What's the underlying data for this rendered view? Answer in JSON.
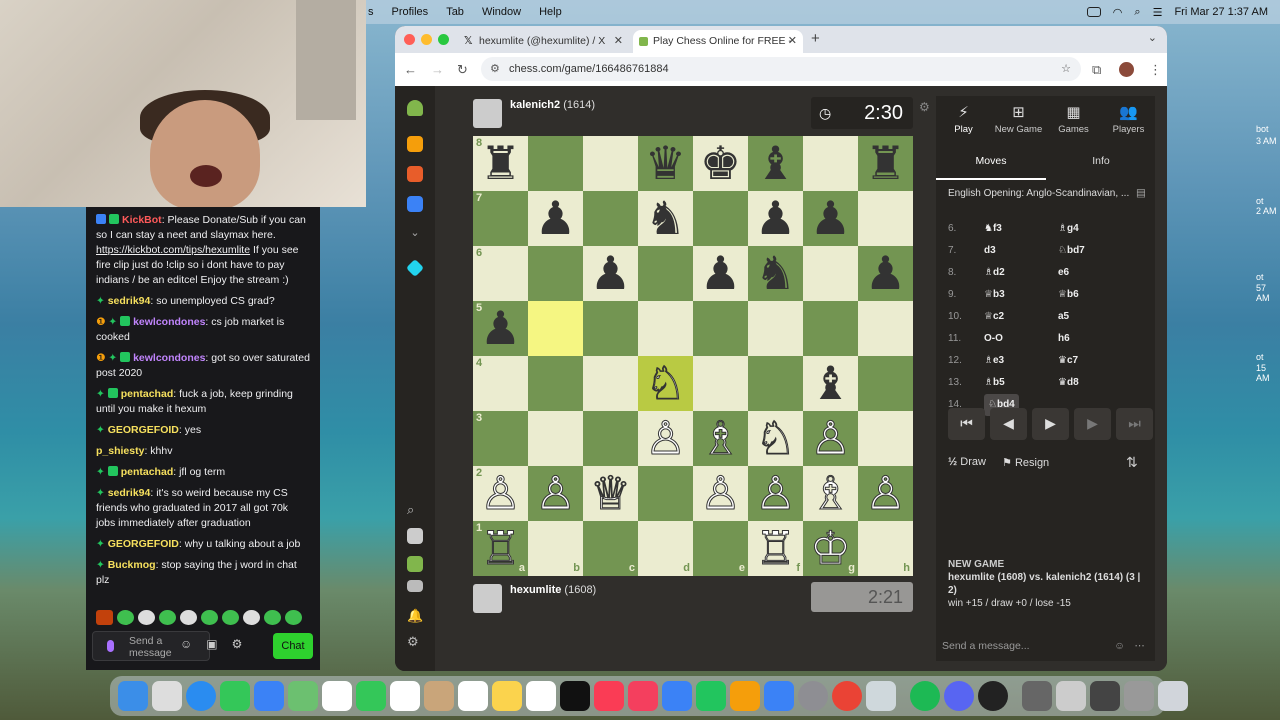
{
  "menubar": {
    "items": [
      "s",
      "Profiles",
      "Tab",
      "Window",
      "Help"
    ],
    "datetime": "Fri Mar 27  1:37 AM"
  },
  "desktop_labels": [
    "bot",
    "3 AM",
    "ot",
    "2 AM",
    "ot",
    "57 AM",
    "ot",
    "15 AM"
  ],
  "chat": {
    "messages": [
      {
        "user": "KickBot",
        "text": "Please Donate/Sub if you can so I can stay a neet and slaymax here.",
        "link": "https://kickbot.com/tips/hexumlite",
        "after": "If you see fire clip just do !clip so i dont have to pay indians / be an editcel Enjoy the stream :)",
        "color": "#ff5a5a"
      },
      {
        "user": "sedrik94",
        "text": "so unemployed CS grad?",
        "color": "#f6e05e"
      },
      {
        "user": "kewlcondones",
        "text": "cs job market is cooked",
        "color": "#c084fc"
      },
      {
        "user": "kewlcondones",
        "text": "got so over saturated post 2020",
        "color": "#c084fc"
      },
      {
        "user": "pentachad",
        "text": "fuck a job, keep grinding until you make it hexum",
        "color": "#f6e05e"
      },
      {
        "user": "GEORGEFOID",
        "text": "yes",
        "color": "#f6e05e"
      },
      {
        "user": "p_shiesty",
        "text": "khhv",
        "color": "#f6e05e"
      },
      {
        "user": "pentachad",
        "text": "jfl og term",
        "color": "#f6e05e"
      },
      {
        "user": "sedrik94",
        "text": "it's so weird because my CS friends who graduated in 2017 all got 70k jobs immediately after graduation",
        "color": "#f6e05e"
      },
      {
        "user": "GEORGEFOID",
        "text": "why u talking about a job",
        "color": "#f6e05e"
      },
      {
        "user": "Buckmog",
        "text": "stop saying the j word in chat plz",
        "color": "#f6e05e"
      }
    ],
    "input_placeholder": "Send a message",
    "chat_button": "Chat"
  },
  "browser": {
    "tabs": [
      {
        "label": "hexumlite (@hexumlite) / X"
      },
      {
        "label": "Play Chess Online for FREE -"
      }
    ],
    "new_tab": "+",
    "url": "chess.com/game/166486761884"
  },
  "game": {
    "top_player": {
      "name": "kalenich2",
      "rating": "(1614)",
      "clock": "2:30"
    },
    "bottom_player": {
      "name": "hexumlite",
      "rating": "(1608)",
      "clock": "2:21"
    },
    "ranks": [
      "8",
      "7",
      "6",
      "5",
      "4",
      "3",
      "2",
      "1"
    ],
    "files": [
      "a",
      "b",
      "c",
      "d",
      "e",
      "f",
      "g",
      "h"
    ],
    "board": [
      [
        "♜",
        "",
        "",
        "♛",
        "♚",
        "♝",
        "",
        "♜"
      ],
      [
        "",
        "♟",
        "",
        "♞",
        "",
        "♟",
        "♟",
        ""
      ],
      [
        "",
        "",
        "♟",
        "",
        "♟",
        "♞",
        "",
        "♟"
      ],
      [
        "♟",
        "",
        "",
        "",
        "",
        "",
        "",
        ""
      ],
      [
        "",
        "",
        "",
        "♘",
        "",
        "",
        "♝",
        ""
      ],
      [
        "",
        "",
        "",
        "♙",
        "♗",
        "♘",
        "♙",
        ""
      ],
      [
        "♙",
        "♙",
        "♕",
        "",
        "♙",
        "♙",
        "♗",
        "♙"
      ],
      [
        "♖",
        "",
        "",
        "",
        "",
        "♖",
        "♔",
        ""
      ]
    ]
  },
  "panel": {
    "tabs": [
      {
        "icon": "⚡",
        "label": "Play"
      },
      {
        "icon": "⊞",
        "label": "New Game"
      },
      {
        "icon": "▦",
        "label": "Games"
      },
      {
        "icon": "👥",
        "label": "Players"
      }
    ],
    "subtabs": [
      "Moves",
      "Info"
    ],
    "opening": "English Opening: Anglo-Scandinavian, ...",
    "moves": [
      {
        "n": "6.",
        "w": "♞f3",
        "b": "♗g4"
      },
      {
        "n": "7.",
        "w": "d3",
        "b": "♘bd7"
      },
      {
        "n": "8.",
        "w": "♗d2",
        "b": "e6"
      },
      {
        "n": "9.",
        "w": "♕b3",
        "b": "♕b6"
      },
      {
        "n": "10.",
        "w": "♕c2",
        "b": "a5"
      },
      {
        "n": "11.",
        "w": "O-O",
        "b": "h6"
      },
      {
        "n": "12.",
        "w": "♗e3",
        "b": "♛c7"
      },
      {
        "n": "13.",
        "w": "♗b5",
        "b": "♛d8"
      },
      {
        "n": "14.",
        "w": "♘bd4",
        "b": ""
      }
    ],
    "draw": "Draw",
    "draw_icon": "½",
    "resign": "Resign",
    "newgame_title": "NEW GAME",
    "newgame_line": "hexumlite (1608) vs. kalenich2 (1614) (3 | 2)",
    "newgame_result": "win +15 / draw +0 / lose -15",
    "message_placeholder": "Send a message..."
  }
}
